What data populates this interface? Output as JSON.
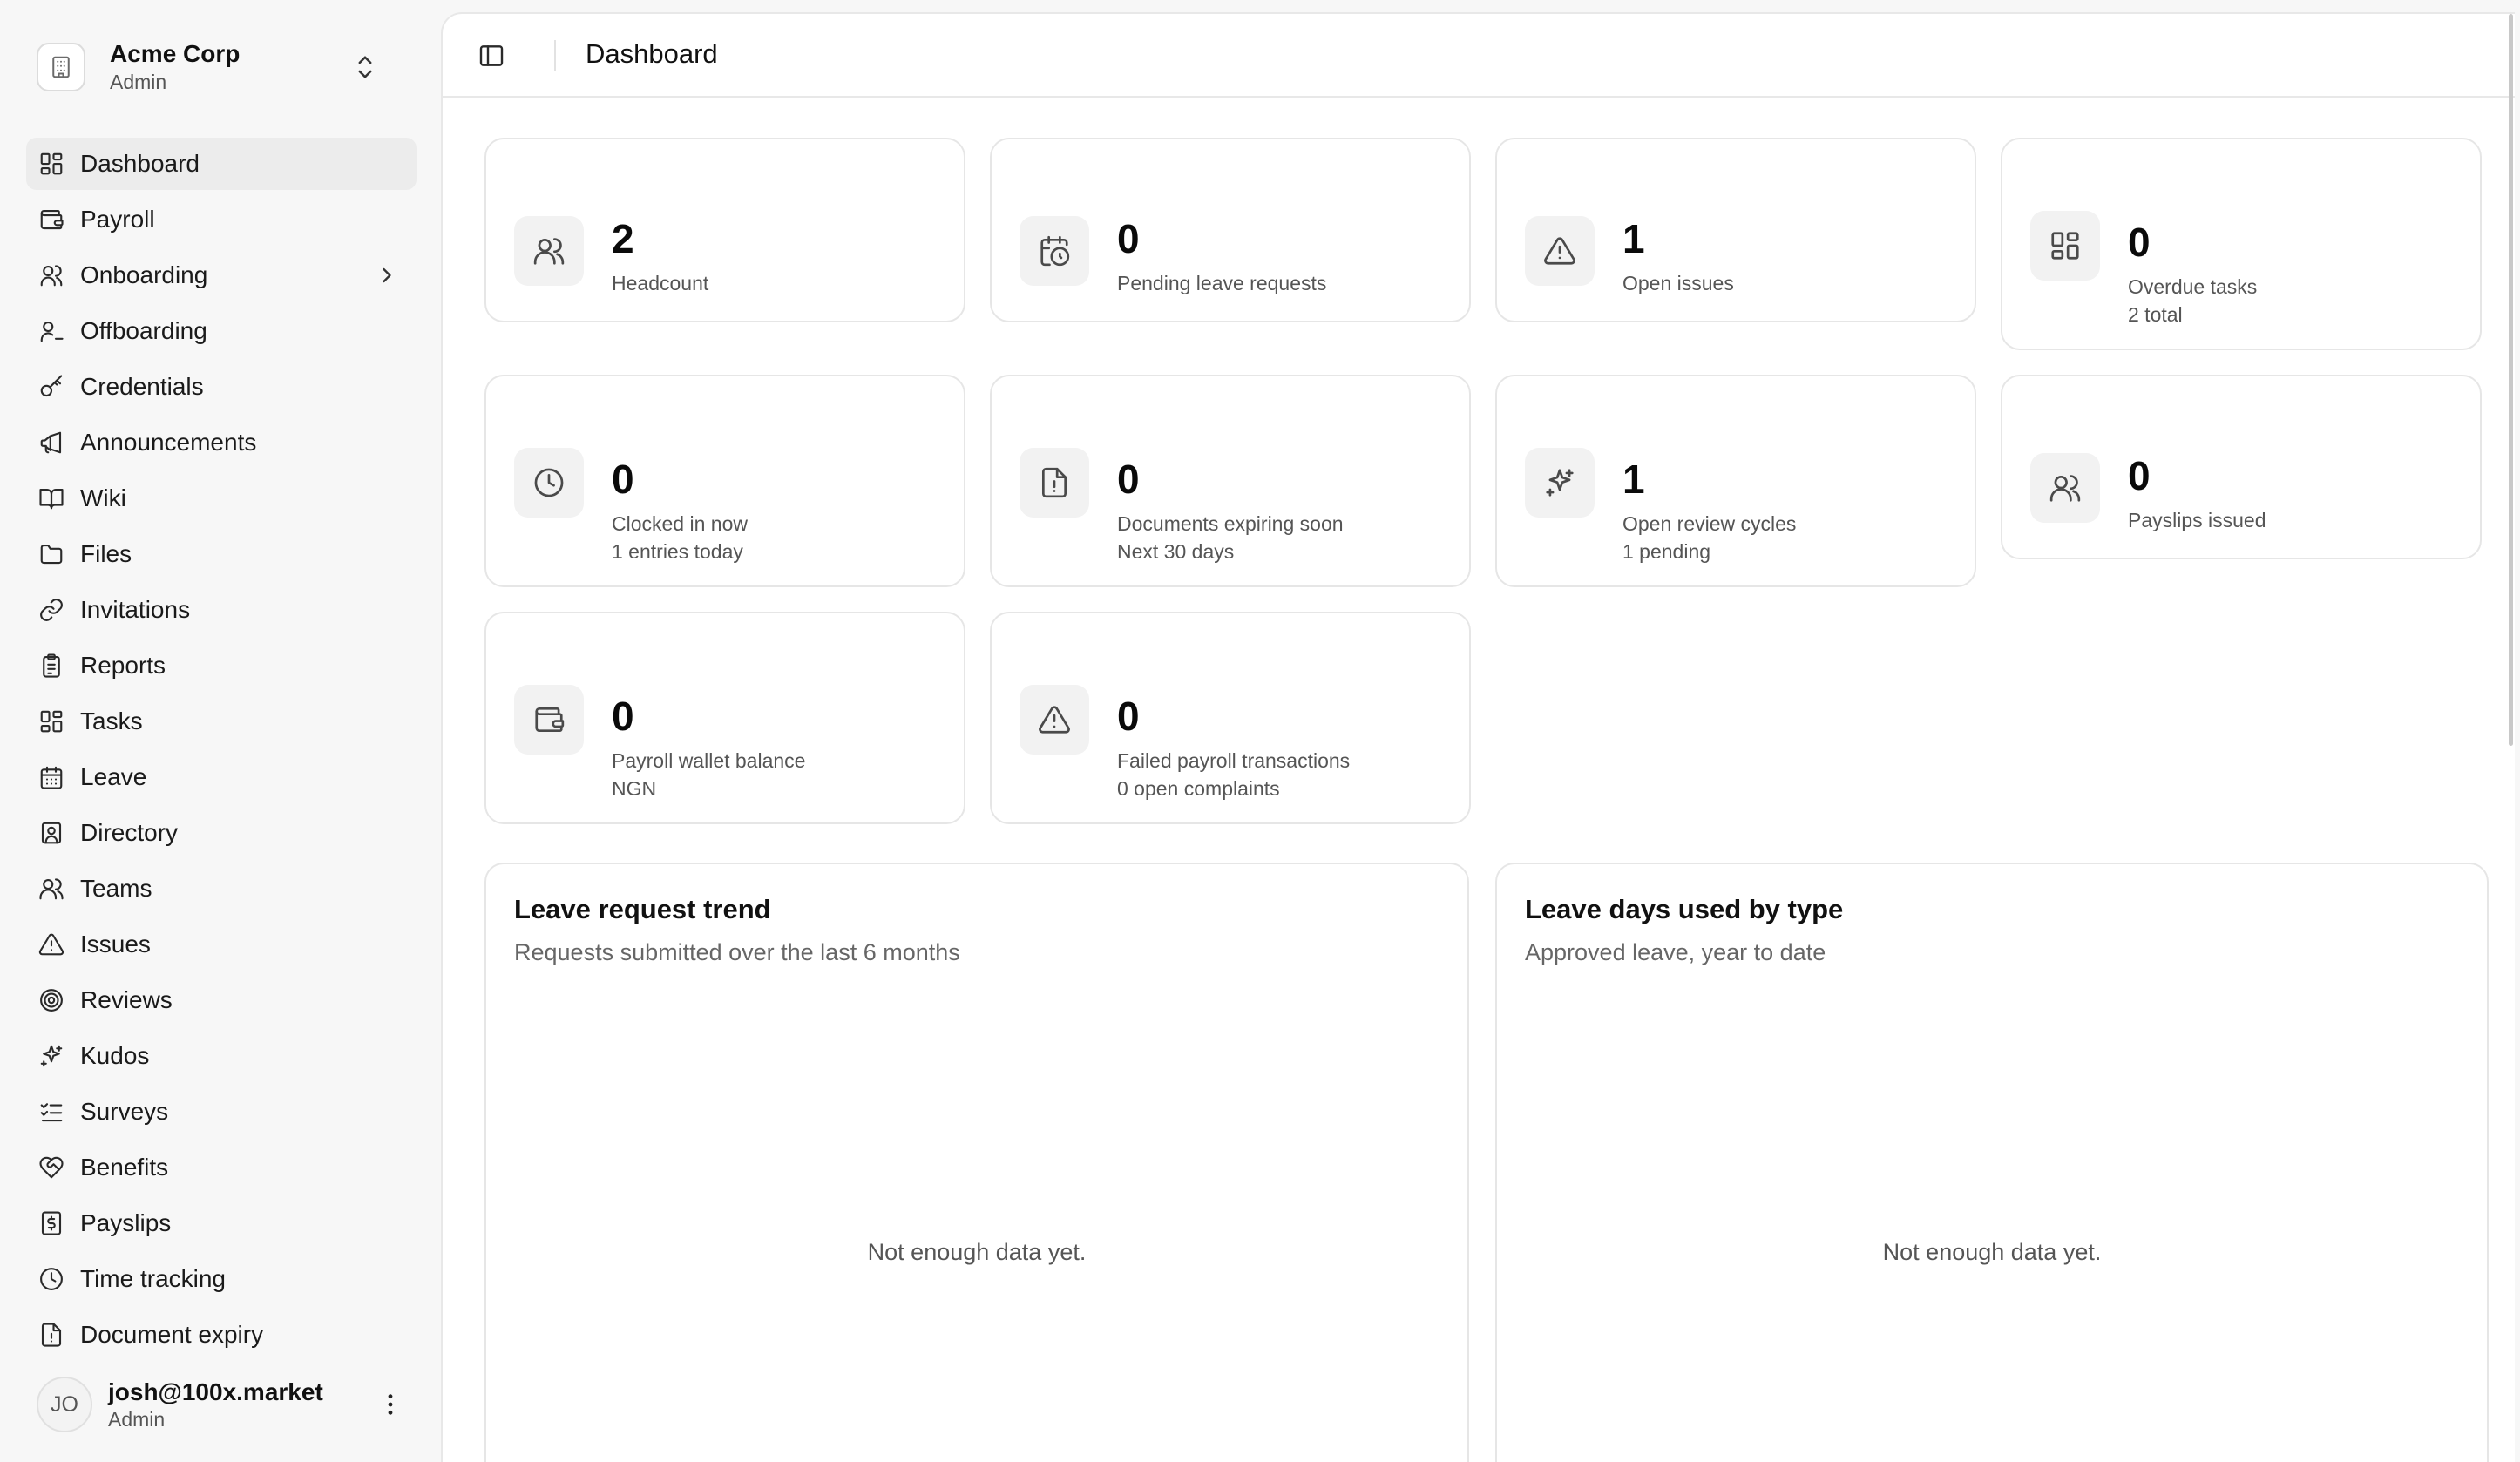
{
  "org": {
    "name": "Acme Corp",
    "role": "Admin"
  },
  "sidebar": {
    "items": [
      {
        "label": "Dashboard",
        "icon": "dashboard-icon",
        "active": true
      },
      {
        "label": "Payroll",
        "icon": "wallet-icon"
      },
      {
        "label": "Onboarding",
        "icon": "user-add-icon",
        "expandable": true
      },
      {
        "label": "Offboarding",
        "icon": "user-remove-icon"
      },
      {
        "label": "Credentials",
        "icon": "key-icon"
      },
      {
        "label": "Announcements",
        "icon": "megaphone-icon"
      },
      {
        "label": "Wiki",
        "icon": "book-icon"
      },
      {
        "label": "Files",
        "icon": "folder-icon"
      },
      {
        "label": "Invitations",
        "icon": "link-icon"
      },
      {
        "label": "Reports",
        "icon": "clipboard-icon"
      },
      {
        "label": "Tasks",
        "icon": "grid-icon"
      },
      {
        "label": "Leave",
        "icon": "calendar-icon"
      },
      {
        "label": "Directory",
        "icon": "contact-card-icon"
      },
      {
        "label": "Teams",
        "icon": "users-icon"
      },
      {
        "label": "Issues",
        "icon": "warning-icon"
      },
      {
        "label": "Reviews",
        "icon": "target-icon"
      },
      {
        "label": "Kudos",
        "icon": "sparkles-icon"
      },
      {
        "label": "Surveys",
        "icon": "checklist-icon"
      },
      {
        "label": "Benefits",
        "icon": "heart-handshake-icon"
      },
      {
        "label": "Payslips",
        "icon": "receipt-icon"
      },
      {
        "label": "Time tracking",
        "icon": "clock-icon"
      },
      {
        "label": "Document expiry",
        "icon": "file-alert-icon"
      }
    ]
  },
  "user": {
    "initials": "JO",
    "email": "josh@100x.market",
    "role": "Admin"
  },
  "header": {
    "title": "Dashboard"
  },
  "stats": [
    {
      "value": "2",
      "label": "Headcount",
      "sub": "",
      "icon": "users-icon"
    },
    {
      "value": "0",
      "label": "Pending leave requests",
      "sub": "",
      "icon": "calendar-clock-icon"
    },
    {
      "value": "1",
      "label": "Open issues",
      "sub": "",
      "icon": "warning-icon"
    },
    {
      "value": "0",
      "label": "Overdue tasks",
      "sub": "2 total",
      "icon": "grid-icon"
    },
    {
      "value": "0",
      "label": "Clocked in now",
      "sub": "1 entries today",
      "icon": "clock-icon"
    },
    {
      "value": "0",
      "label": "Documents expiring soon",
      "sub": "Next 30 days",
      "icon": "file-alert-icon"
    },
    {
      "value": "1",
      "label": "Open review cycles",
      "sub": "1 pending",
      "icon": "sparkles-icon"
    },
    {
      "value": "0",
      "label": "Payslips issued",
      "sub": "",
      "icon": "users-icon"
    },
    {
      "value": "0",
      "label": "Payroll wallet balance",
      "sub": "NGN",
      "icon": "wallet-icon"
    },
    {
      "value": "0",
      "label": "Failed payroll transactions",
      "sub": "0 open complaints",
      "icon": "warning-icon"
    }
  ],
  "charts": [
    {
      "title": "Leave request trend",
      "subtitle": "Requests submitted over the last 6 months",
      "empty": "Not enough data yet."
    },
    {
      "title": "Leave days used by type",
      "subtitle": "Approved leave, year to date",
      "empty": "Not enough data yet."
    }
  ],
  "colors": {
    "accent": "#0a0a0a",
    "sidebar_bg": "#f7f7f7",
    "active_bg": "#ececec",
    "card_border": "#e6e6e6"
  }
}
